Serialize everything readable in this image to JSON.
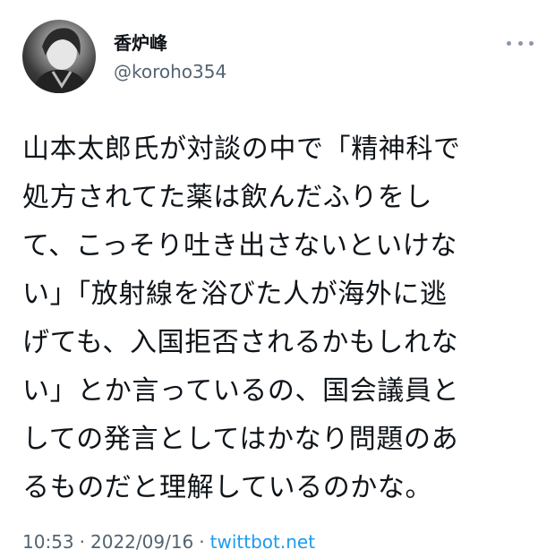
{
  "author": {
    "display_name": "香炉峰",
    "handle": "@koroho354"
  },
  "icons": {
    "avatar": "profile-avatar",
    "more": "more-horizontal-icon"
  },
  "tweet": {
    "lines": [
      "山本太郎氏が対談の中で「精神科で",
      "処方されてた薬は飲んだふりをし",
      "て、こっそり吐き出さないといけな",
      "い」「放射線を浴びた人が海外に逃",
      "げても、入国拒否されるかもしれな",
      "い」とか言っているの、国会議員と",
      "しての発言としてはかなり問題のあ",
      "るものだと理解しているのかな。"
    ]
  },
  "meta": {
    "time": "10:53",
    "separator": "·",
    "date": "2022/09/16",
    "source": "twittbot.net"
  },
  "colors": {
    "text": "#0f1419",
    "secondary": "#536471",
    "link": "#1d9bf0"
  }
}
